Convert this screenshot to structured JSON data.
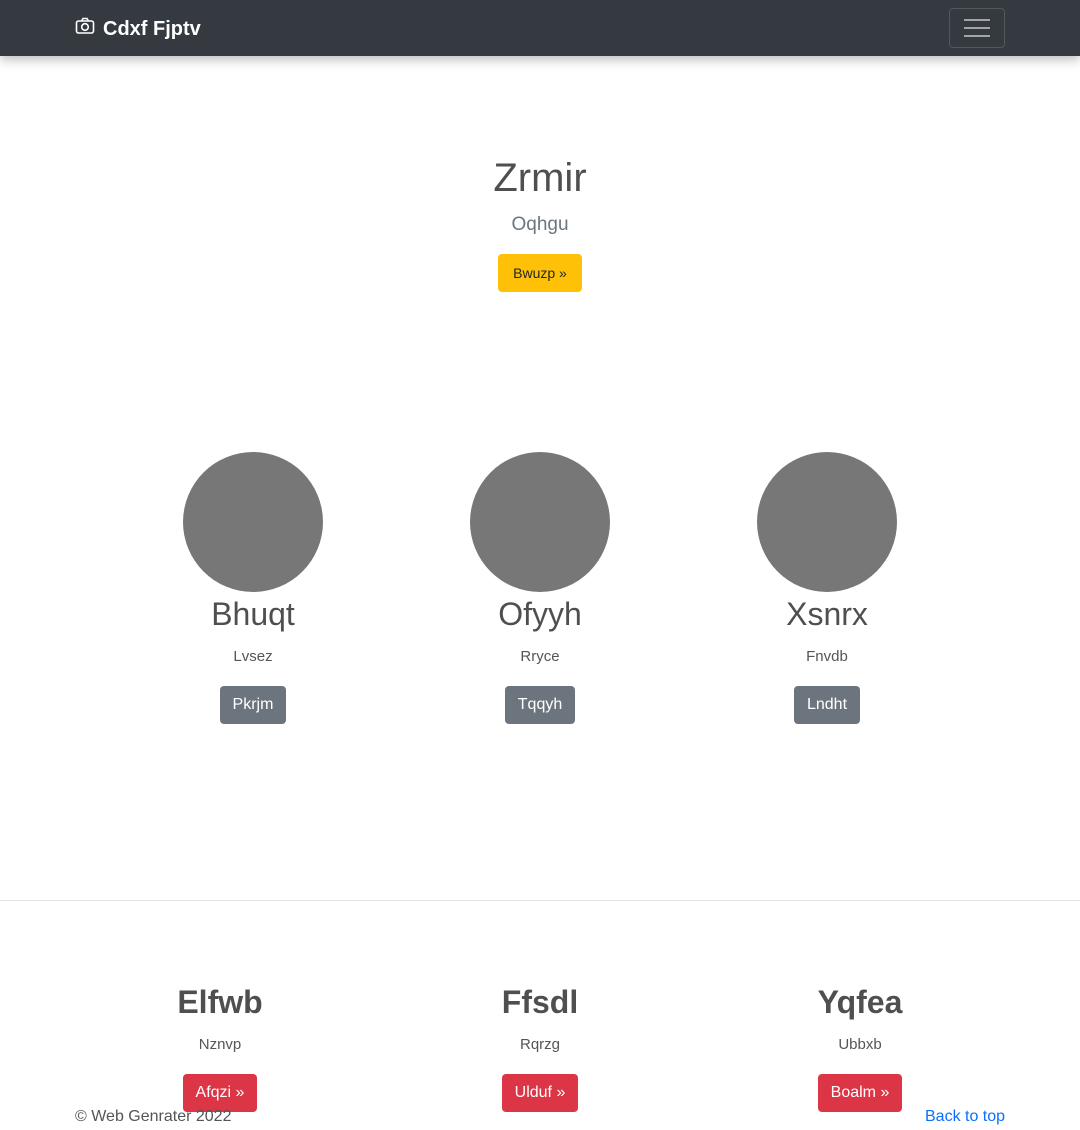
{
  "navbar": {
    "brand_icon": "camera-icon",
    "brand": "Cdxf Fjptv",
    "toggler_icon": "hamburger-menu-icon"
  },
  "hero": {
    "title": "Zrmir",
    "lead": "Oqhgu",
    "button": "Bwuzp »",
    "button_color": "#ffc107"
  },
  "profiles": [
    {
      "name": "Bhuqt",
      "sub": "Lvsez",
      "button": "Pkrjm"
    },
    {
      "name": "Ofyyh",
      "sub": "Rryce",
      "button": "Tqqyh"
    },
    {
      "name": "Xsnrx",
      "sub": "Fnvdb",
      "button": "Lndht"
    }
  ],
  "features": [
    {
      "title": "Elfwb",
      "sub": "Nznvp",
      "button": "Afqzi »"
    },
    {
      "title": "Ffsdl",
      "sub": "Rqrzg",
      "button": "Ulduf »"
    },
    {
      "title": "Yqfea",
      "sub": "Ubbxb",
      "button": "Boalm »"
    }
  ],
  "footer": {
    "copyright": "© Web Genrater 2022",
    "back_to_top": "Back to top"
  },
  "colors": {
    "navbar": "#343a40",
    "secondary": "#6c757d",
    "danger": "#dc3545",
    "link": "#0d6efd",
    "placeholder": "#777777"
  }
}
